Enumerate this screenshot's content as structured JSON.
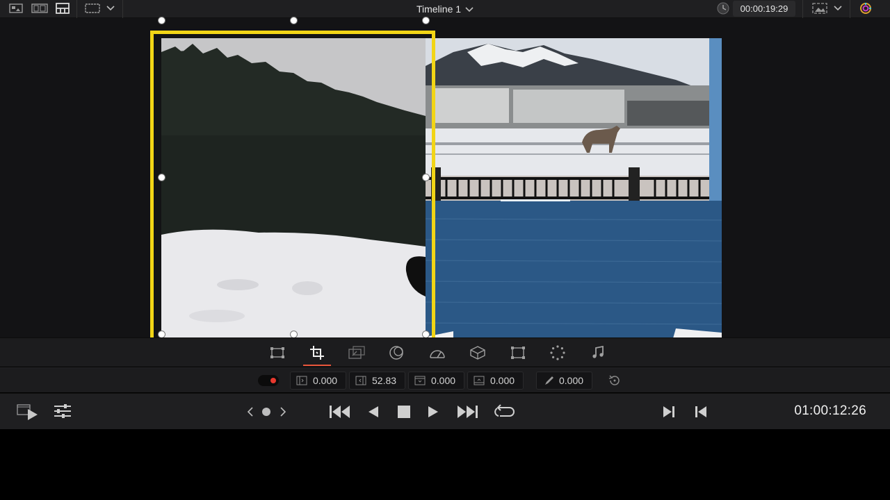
{
  "topbar": {
    "timeline_title": "Timeline 1",
    "timecode": "00:00:19:29",
    "icons": [
      "viewer-single-icon",
      "viewer-compare-icon",
      "viewer-grid-icon",
      "window-frame-icon",
      "chevron-down-icon",
      "clock-icon",
      "image-overlay-icon",
      "chevron-down-icon",
      "color-wheel-icon"
    ]
  },
  "viewer": {
    "selection_color": "#f2d516"
  },
  "tools": [
    {
      "name": "transform-tool",
      "icon": "transform-icon"
    },
    {
      "name": "crop-tool",
      "icon": "crop-icon",
      "active": true
    },
    {
      "name": "dynamic-zoom-tool",
      "icon": "dynamic-zoom-icon"
    },
    {
      "name": "composite-tool",
      "icon": "composite-icon"
    },
    {
      "name": "speed-tool",
      "icon": "speedometer-icon"
    },
    {
      "name": "stabilization-tool",
      "icon": "stabilization-icon"
    },
    {
      "name": "lens-correction-tool",
      "icon": "lens-correction-icon"
    },
    {
      "name": "smart-reframe-tool",
      "icon": "smart-reframe-icon"
    },
    {
      "name": "audio-tool",
      "icon": "music-note-icon"
    }
  ],
  "params": {
    "crop_left": "0.000",
    "crop_right": "52.83",
    "crop_top": "0.000",
    "crop_bottom": "0.000",
    "softness": "0.000"
  },
  "transport": {
    "timecode": "01:00:12:26"
  },
  "accent": "#e8553a"
}
